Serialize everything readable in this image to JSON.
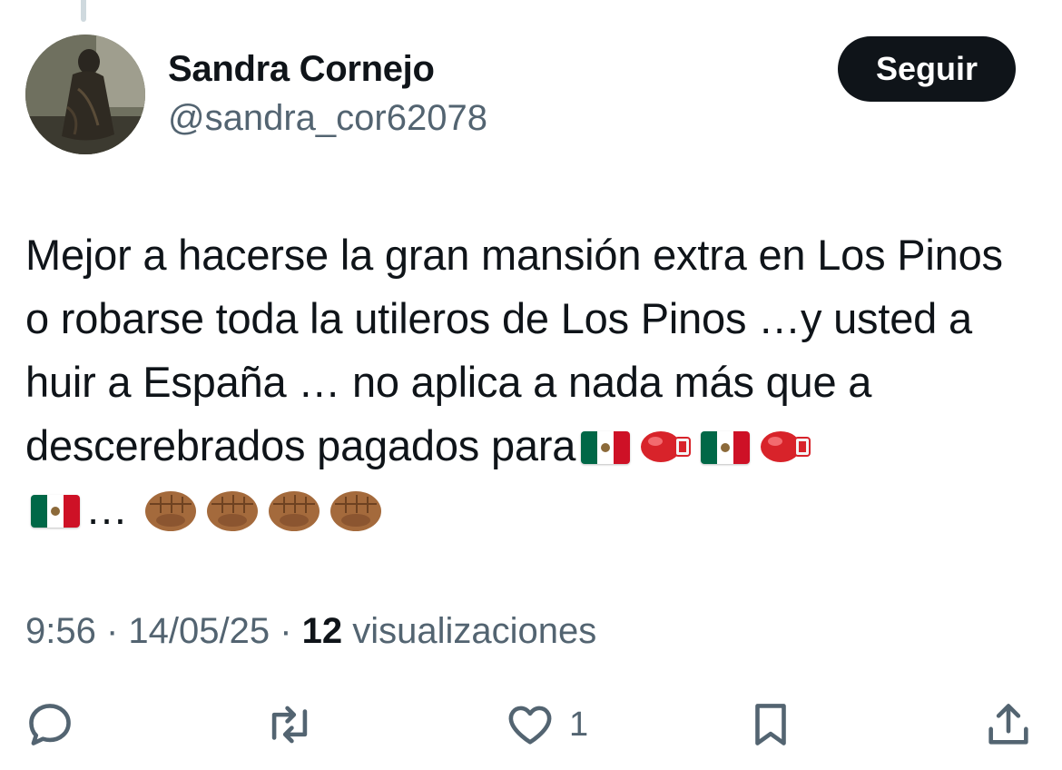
{
  "author": {
    "display_name": "Sandra Cornejo",
    "handle": "@sandra_cor62078"
  },
  "follow_button": {
    "label": "Seguir"
  },
  "tweet": {
    "text_main": "Mejor a hacerse la gran mansión extra en Los Pinos o robarse toda la utileros de Los Pinos …y usted a huir a España … no aplica a nada más que a descerebrados pagados para",
    "text_ellipsis": "…",
    "emojis": [
      "flag-mexico-icon",
      "boxing-glove-icon",
      "flag-mexico-icon",
      "boxing-glove-icon",
      "flag-mexico-icon",
      "fist-icon",
      "fist-icon",
      "fist-icon",
      "fist-icon"
    ]
  },
  "meta": {
    "time": "9:56",
    "separator": " · ",
    "date": "14/05/25",
    "views_count": "12",
    "views_label": " visualizaciones"
  },
  "actions": {
    "reply_icon": "reply-icon",
    "retweet_icon": "retweet-icon",
    "like_icon": "heart-icon",
    "like_count": "1",
    "bookmark_icon": "bookmark-icon",
    "share_icon": "share-icon"
  },
  "colors": {
    "text_primary": "#0f1419",
    "text_secondary": "#536471",
    "button_bg": "#0f1419",
    "button_text": "#ffffff"
  }
}
